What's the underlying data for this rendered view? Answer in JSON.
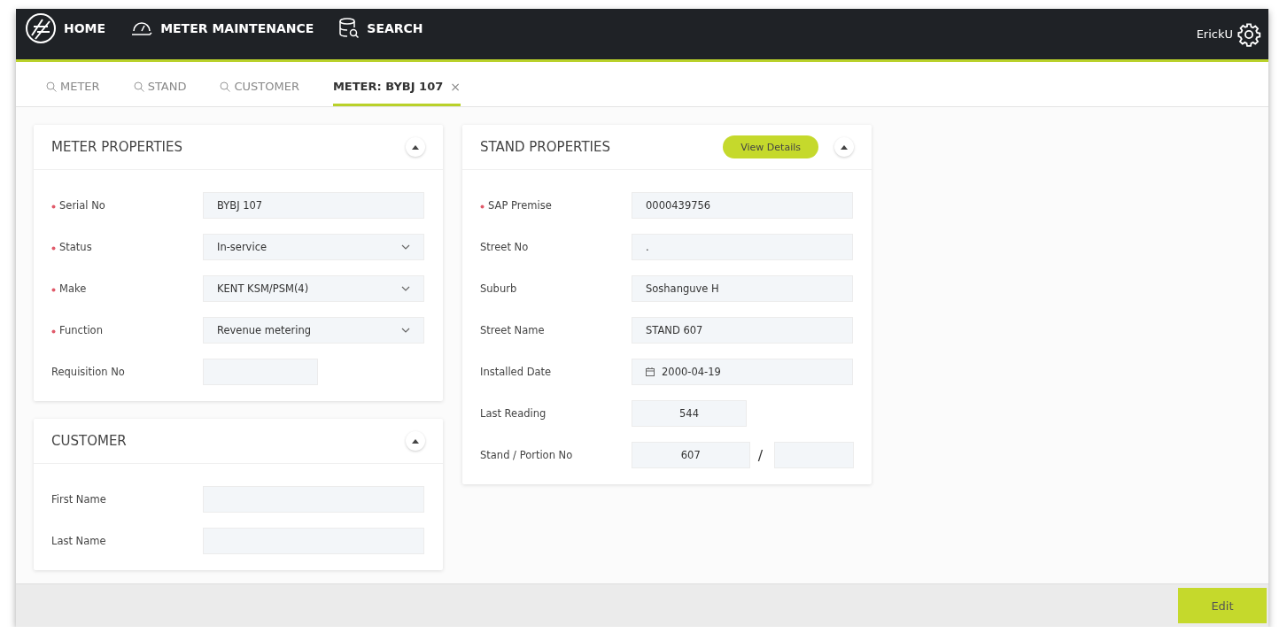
{
  "nav": {
    "items": [
      {
        "label": "HOME",
        "kind": "home"
      },
      {
        "label": "METER MAINTENANCE",
        "kind": "meter"
      },
      {
        "label": "SEARCH",
        "kind": "search"
      }
    ],
    "user": "ErickU"
  },
  "tabs": [
    {
      "label": "METER",
      "kind": "search",
      "selected": false
    },
    {
      "label": "STAND",
      "kind": "search",
      "selected": false
    },
    {
      "label": "CUSTOMER",
      "kind": "search",
      "selected": false
    },
    {
      "label": "METER: BYBJ 107",
      "kind": "record",
      "close": "×",
      "selected": true
    }
  ],
  "meter_properties": {
    "title": "METER PROPERTIES",
    "fields": [
      {
        "label": "Serial No",
        "required": true,
        "kind": "text",
        "value": "BYBJ 107"
      },
      {
        "label": "Status",
        "required": true,
        "kind": "select",
        "value": "In-service"
      },
      {
        "label": "Make",
        "required": true,
        "kind": "select",
        "value": "KENT KSM/PSM(4)"
      },
      {
        "label": "Function",
        "required": true,
        "kind": "select",
        "value": "Revenue metering"
      },
      {
        "label": "Requisition No",
        "required": false,
        "kind": "short"
      }
    ]
  },
  "customer": {
    "title": "CUSTOMER",
    "fields": [
      {
        "label": "First Name",
        "required": false,
        "kind": "text"
      },
      {
        "label": "Last Name",
        "required": false,
        "kind": "text"
      }
    ]
  },
  "stand_properties": {
    "title": "STAND PROPERTIES",
    "action": "View Details",
    "fields": [
      {
        "label": "SAP Premise",
        "required": true,
        "kind": "text",
        "value": "0000439756"
      },
      {
        "label": "Street No",
        "required": false,
        "kind": "text",
        "value": "."
      },
      {
        "label": "Suburb",
        "required": false,
        "kind": "text",
        "value": "Soshanguve H"
      },
      {
        "label": "Street Name",
        "required": false,
        "kind": "text",
        "value": "STAND 607"
      },
      {
        "label": "Installed Date",
        "required": false,
        "kind": "date",
        "value": "2000-04-19"
      },
      {
        "label": "Last Reading",
        "required": false,
        "kind": "short",
        "value": "544"
      },
      {
        "label": "Stand / Portion No",
        "required": false,
        "kind": "split",
        "value": "607",
        "separator": "/"
      }
    ]
  },
  "footer": {
    "button": "Edit"
  }
}
